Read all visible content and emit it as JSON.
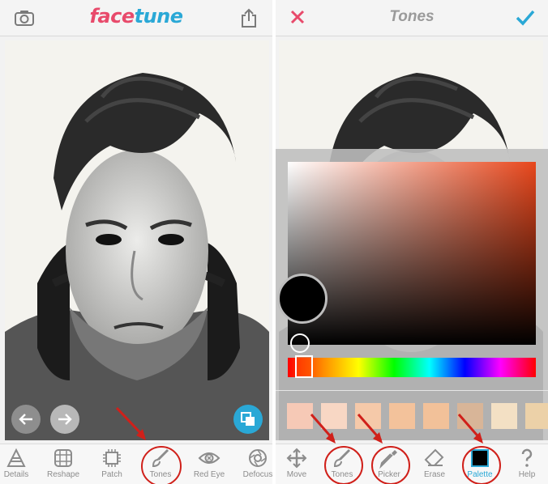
{
  "left": {
    "logo_part1": "face",
    "logo_part2": "tune",
    "tools": [
      {
        "label": "Details"
      },
      {
        "label": "Reshape"
      },
      {
        "label": "Patch"
      },
      {
        "label": "Tones"
      },
      {
        "label": "Red Eye"
      },
      {
        "label": "Defocus"
      }
    ]
  },
  "right": {
    "title": "Tones",
    "tools": [
      {
        "label": "Move"
      },
      {
        "label": "Tones"
      },
      {
        "label": "Picker"
      },
      {
        "label": "Erase"
      },
      {
        "label": "Palette"
      },
      {
        "label": "Help"
      }
    ],
    "swatches": [
      "#f6c9b6",
      "#f8d7c4",
      "#f5c9a9",
      "#f3c29b",
      "#f2c199",
      "#d8b598",
      "#f3e0c4",
      "#ecd1a8"
    ]
  },
  "colors": {
    "brand_pink": "#e84a6b",
    "brand_blue": "#2aa8d6",
    "annotation_red": "#d0201a",
    "selected_color": "#000000"
  }
}
